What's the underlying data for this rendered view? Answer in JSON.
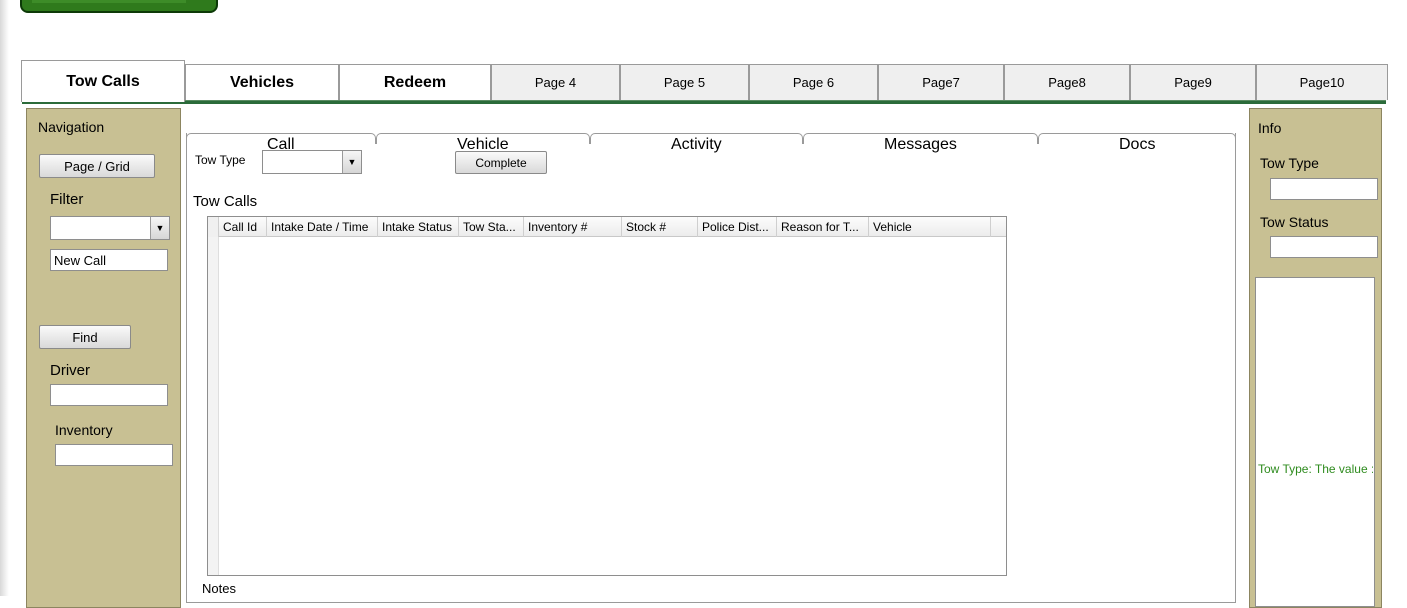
{
  "top_tabs": [
    {
      "label": "Tow Calls"
    },
    {
      "label": "Vehicles"
    },
    {
      "label": "Redeem"
    },
    {
      "label": "Page 4"
    },
    {
      "label": "Page 5"
    },
    {
      "label": "Page 6"
    },
    {
      "label": "Page7"
    },
    {
      "label": "Page8"
    },
    {
      "label": "Page9"
    },
    {
      "label": "Page10"
    }
  ],
  "left_panel": {
    "title": "Navigation",
    "page_grid_button": "Page / Grid",
    "filter_label": "Filter",
    "filter_value": "",
    "new_call_value": "New Call",
    "find_button": "Find",
    "driver_label": "Driver",
    "driver_value": "",
    "inventory_label": "Inventory",
    "inventory_value": ""
  },
  "sub_tabs": [
    {
      "label": "Call"
    },
    {
      "label": "Vehicle"
    },
    {
      "label": "Activity"
    },
    {
      "label": "Messages"
    },
    {
      "label": "Docs"
    }
  ],
  "main": {
    "tow_type_label": "Tow Type",
    "tow_type_value": "",
    "complete_button": "Complete",
    "section_title": "Tow Calls",
    "notes_label": "Notes"
  },
  "grid": {
    "columns": [
      "Call Id",
      "Intake Date / Time",
      "Intake Status",
      "Tow Sta...",
      "Inventory #",
      "Stock #",
      "Police Dist...",
      "Reason for T...",
      "Vehicle"
    ],
    "rows": []
  },
  "right_panel": {
    "title": "Info",
    "tow_type_label": "Tow Type",
    "tow_type_value": "",
    "tow_status_label": "Tow Status",
    "tow_status_value": "",
    "validation_message": "Tow Type: The value :"
  },
  "colors": {
    "panel_bg": "#c8c093",
    "tab_underline": "#2b6b3a",
    "validation_text": "#2e8b1e"
  }
}
